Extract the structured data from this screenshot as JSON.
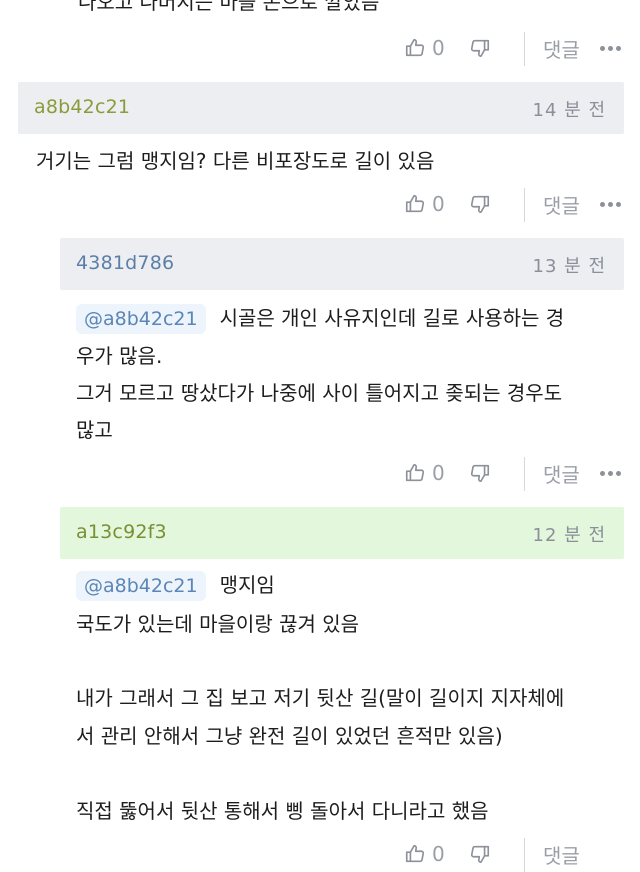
{
  "comments": [
    {
      "body_lines": [
        "나오고 나머지는 마을 돈으로 깔았음"
      ],
      "likes": "0",
      "reply_label": "댓글"
    },
    {
      "author": "a8b42c21",
      "author_color": "#8c9a3a",
      "time": "14 분 전",
      "body_lines": [
        "거기는 그럼 맹지임? 다른 비포장도로 길이 있음"
      ],
      "likes": "0",
      "reply_label": "댓글"
    },
    {
      "author": "4381d786",
      "author_color": "#5c7fa8",
      "time": "13 분 전",
      "mention": "@a8b42c21",
      "body_lines": [
        "시골은 개인 사유지인데 길로 사용하는 경",
        "우가 많음.",
        "그거 모르고 땅샀다가 나중에 사이 틀어지고 좆되는 경우도",
        "많고"
      ],
      "likes": "0",
      "reply_label": "댓글"
    },
    {
      "author": "a13c92f3",
      "author_color": "#7a8e34",
      "time": "12 분 전",
      "mention": "@a8b42c21",
      "body_lines": [
        "맹지임",
        "국도가 있는데 마을이랑 끊겨 있음",
        "내가 그래서 그 집 보고 저기 뒷산 길(말이 길이지 지자체에",
        "서 관리 안해서 그냥 완전 길이 있었던 흔적만 있음)",
        "직접 뚫어서 뒷산 통해서 삥 돌아서 다니라고 했음"
      ],
      "likes": "0",
      "reply_label": "댓글"
    }
  ],
  "icons": {
    "like": "thumbs-up-icon",
    "dislike": "thumbs-down-icon",
    "more": "more-dots-icon"
  },
  "colors": {
    "header_grey": "#eceef1",
    "header_green": "#e3f7dc",
    "mention_bg": "#eef4fb",
    "mention_text": "#5a86b8",
    "muted": "#9a9ea6"
  }
}
